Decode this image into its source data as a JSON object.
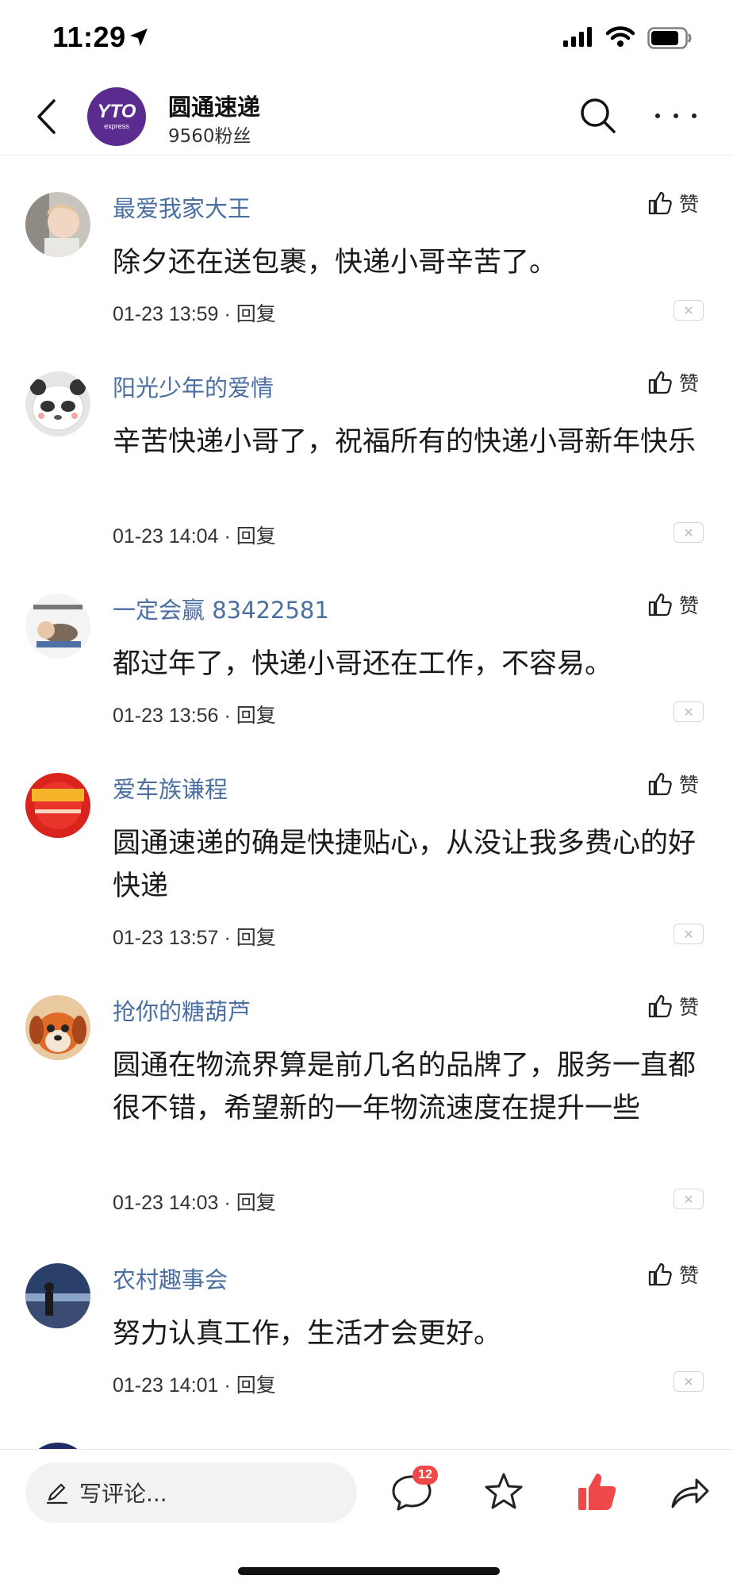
{
  "status_bar": {
    "time": "11:29"
  },
  "header": {
    "logo_text": "YTO",
    "logo_subtext": "express",
    "account_name": "圆通速递",
    "followers": "9560粉丝"
  },
  "like_label": "赞",
  "reply_label": "回复",
  "comments": [
    {
      "name": "最爱我家大王",
      "text": "除夕还在送包裹，快递小哥辛苦了。",
      "time": "01-23 13:59",
      "avatar": "baby-photo"
    },
    {
      "name": "阳光少年的爱情",
      "text": "辛苦快递小哥了，祝福所有的快递小哥新年快乐",
      "time": "01-23 14:04",
      "avatar": "panda-cartoon"
    },
    {
      "name": "一定会赢 83422581",
      "text": "都过年了，快递小哥还在工作，不容易。",
      "time": "01-23 13:56",
      "avatar": "sleeping-cartoon"
    },
    {
      "name": "爱车族谦程",
      "text": "圆通速递的确是快捷贴心，从没让我多费心的好快递",
      "time": "01-23 13:57",
      "avatar": "red-logo"
    },
    {
      "name": "抢你的糖葫芦",
      "text": "圆通在物流界算是前几名的品牌了，服务一直都很不错，希望新的一年物流速度在提升一些",
      "time": "01-23 14:03",
      "avatar": "dog-cartoon"
    },
    {
      "name": "农村趣事会",
      "text": "努力认真工作，生活才会更好。",
      "time": "01-23 14:01",
      "avatar": "beach-photo"
    }
  ],
  "bottom_bar": {
    "input_placeholder": "写评论...",
    "comment_count": "12"
  },
  "colors": {
    "username": "#4a6fa0",
    "brand": "#5b2c8f",
    "like_active": "#f04848",
    "badge": "#f04848"
  }
}
